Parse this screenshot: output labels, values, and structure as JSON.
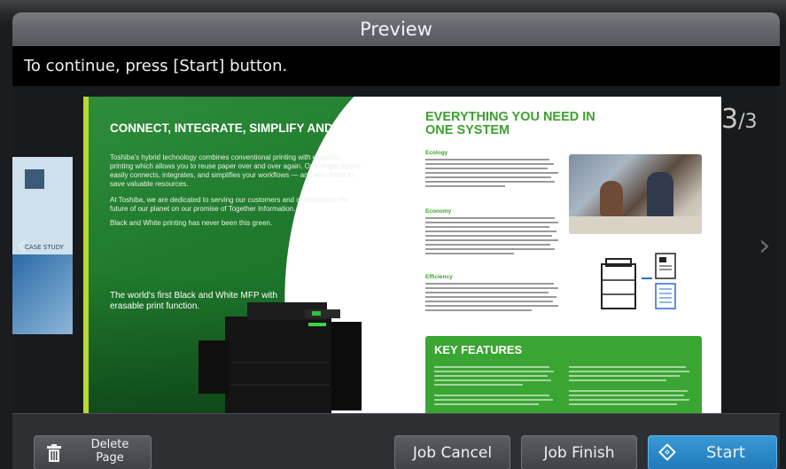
{
  "window": {
    "title": "Preview"
  },
  "instruction": "To continue, press [Start] button.",
  "pager": {
    "current": "3",
    "total": "/3"
  },
  "document": {
    "left_page": {
      "title": "CONNECT, INTEGRATE, SIMPLIFY AND REUSE",
      "paragraphs": [
        "Toshiba's hybrid technology combines conventional printing with erasable printing which allows you to reuse paper over and over again. One single device easily connects, integrates, and simplifies your workflows — and also helps to save valuable resources.",
        "At Toshiba, we are dedicated to serving our customers and committed to the future of our planet on our promise of Together Information.",
        "Black and White printing has never been this green."
      ],
      "caption": "The world's first Black and White MFP with erasable print function."
    },
    "right_page": {
      "title": "EVERYTHING YOU NEED IN ONE SYSTEM",
      "sections": [
        "Ecology",
        "Economy",
        "Efficiency"
      ],
      "key_features_title": "KEY FEATURES"
    },
    "prev_page_label": "CASE STUDY"
  },
  "buttons": {
    "delete_page": "Delete Page",
    "job_cancel": "Job Cancel",
    "job_finish": "Job Finish",
    "start": "Start"
  },
  "colors": {
    "start_button": "#2a8ccb",
    "brand_green": "#3ca12e",
    "title_bar": "#5f6368"
  }
}
